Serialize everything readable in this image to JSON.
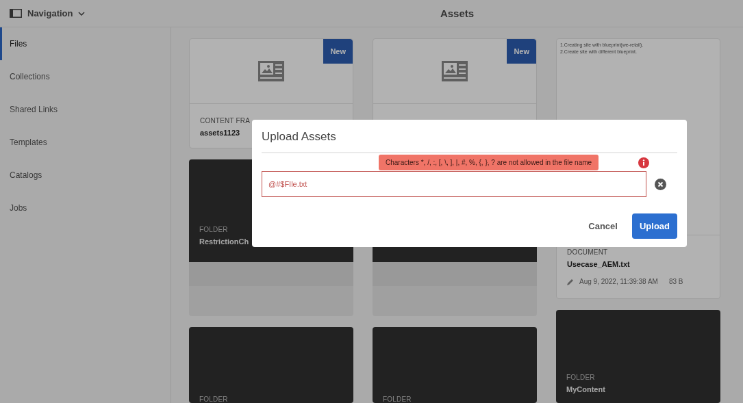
{
  "topbar": {
    "nav_label": "Navigation",
    "title": "Assets"
  },
  "sidebar": {
    "items": [
      {
        "label": "Files",
        "selected": true
      },
      {
        "label": "Collections",
        "selected": false
      },
      {
        "label": "Shared Links",
        "selected": false
      },
      {
        "label": "Templates",
        "selected": false
      },
      {
        "label": "Catalogs",
        "selected": false
      },
      {
        "label": "Jobs",
        "selected": false
      }
    ]
  },
  "columns": [
    [
      {
        "kind": "fragment",
        "badge": "New",
        "type": "CONTENT FRA",
        "name": "assets1123"
      },
      {
        "kind": "folder",
        "type": "FOLDER",
        "name": "RestrictionCh",
        "footer": true
      },
      {
        "kind": "folder",
        "type": "FOLDER",
        "footer": false
      }
    ],
    [
      {
        "kind": "fragment",
        "badge": "New"
      },
      {
        "kind": "folder",
        "footer": true
      },
      {
        "kind": "folder",
        "type": "FOLDER",
        "footer": false
      }
    ],
    [
      {
        "kind": "document",
        "preview": [
          "1.Creating site with blueprint(we-retail).",
          "2.Create site with different blueprint."
        ],
        "type": "DOCUMENT",
        "name": "Usecase_AEM.txt",
        "date": "Aug 9, 2022, 11:39:38 AM",
        "size": "83 B"
      },
      {
        "kind": "folder",
        "type": "FOLDER",
        "name": "MyContent",
        "footer": false
      }
    ]
  ],
  "dialog": {
    "title": "Upload Assets",
    "error": "Characters *, /, :, [, \\, ], |, #, %, {, }, ? are not allowed in the file name",
    "file_name": "@#$FIle.txt",
    "invalid": true,
    "buttons": [
      {
        "label": "Cancel",
        "kind": "quiet"
      },
      {
        "label": "Upload",
        "kind": "primary"
      }
    ]
  }
}
